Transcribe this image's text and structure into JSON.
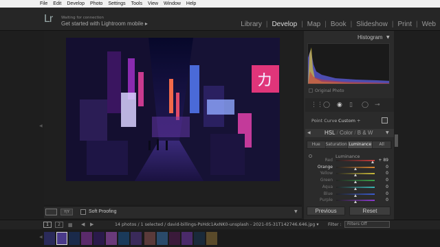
{
  "menubar": {
    "items": [
      "File",
      "Edit",
      "Develop",
      "Photo",
      "Settings",
      "Tools",
      "View",
      "Window",
      "Help"
    ]
  },
  "identity": {
    "logo": "Lr",
    "status": "Waiting for connection",
    "mobile_prompt": "Get started with Lightroom mobile ▸"
  },
  "modules": {
    "items": [
      {
        "label": "Library",
        "active": false
      },
      {
        "label": "Develop",
        "active": true
      },
      {
        "label": "Map",
        "active": false
      },
      {
        "label": "Book",
        "active": false
      },
      {
        "label": "Slideshow",
        "active": false
      },
      {
        "label": "Print",
        "active": false
      },
      {
        "label": "Web",
        "active": false
      }
    ]
  },
  "toolbar": {
    "yy_label": "Y|Y",
    "soft_proofing": "Soft Proofing"
  },
  "right_panel": {
    "histogram_title": "Histogram",
    "original_photo": "Original Photo",
    "point_curve_label": "Point Curve :",
    "point_curve_value": "Custom ÷",
    "hsl": {
      "hsl": "HSL",
      "color": "Color",
      "bw": "B & W"
    },
    "tabs": [
      {
        "label": "Hue",
        "active": false
      },
      {
        "label": "Saturation",
        "active": false
      },
      {
        "label": "Luminance",
        "active": true
      },
      {
        "label": "All",
        "active": false
      }
    ],
    "luminance_title": "Luminance",
    "sliders": [
      {
        "label": "Red",
        "value": "+ 89",
        "level": 0.95,
        "color": "#c63a3a"
      },
      {
        "label": "Orange",
        "value": "0",
        "level": 0.5,
        "color": "#d9852f",
        "highlight": true
      },
      {
        "label": "Yellow",
        "value": "0",
        "level": 0.5,
        "color": "#c9b93a"
      },
      {
        "label": "Green",
        "value": "0",
        "level": 0.5,
        "color": "#3aa24a"
      },
      {
        "label": "Aqua",
        "value": "0",
        "level": 0.5,
        "color": "#3ab4b4"
      },
      {
        "label": "Blue",
        "value": "0",
        "level": 0.5,
        "color": "#3a5ccf"
      },
      {
        "label": "Purple",
        "value": "0",
        "level": 0.5,
        "color": "#8a3acf"
      }
    ],
    "previous_label": "Previous",
    "reset_label": "Reset"
  },
  "filmstrip_bar": {
    "page1": "1",
    "page2": "2",
    "info": "14 photos / 1 selected / david-billings-PsHdc1AxNK0-unsplash - 2021-05-31T142746.646.jpg ▾",
    "filter_label": "Filter :",
    "filter_value": "Filters Off"
  },
  "colors": {
    "accent": "#5a8fd6",
    "panel_bg": "#2b2b2b"
  }
}
